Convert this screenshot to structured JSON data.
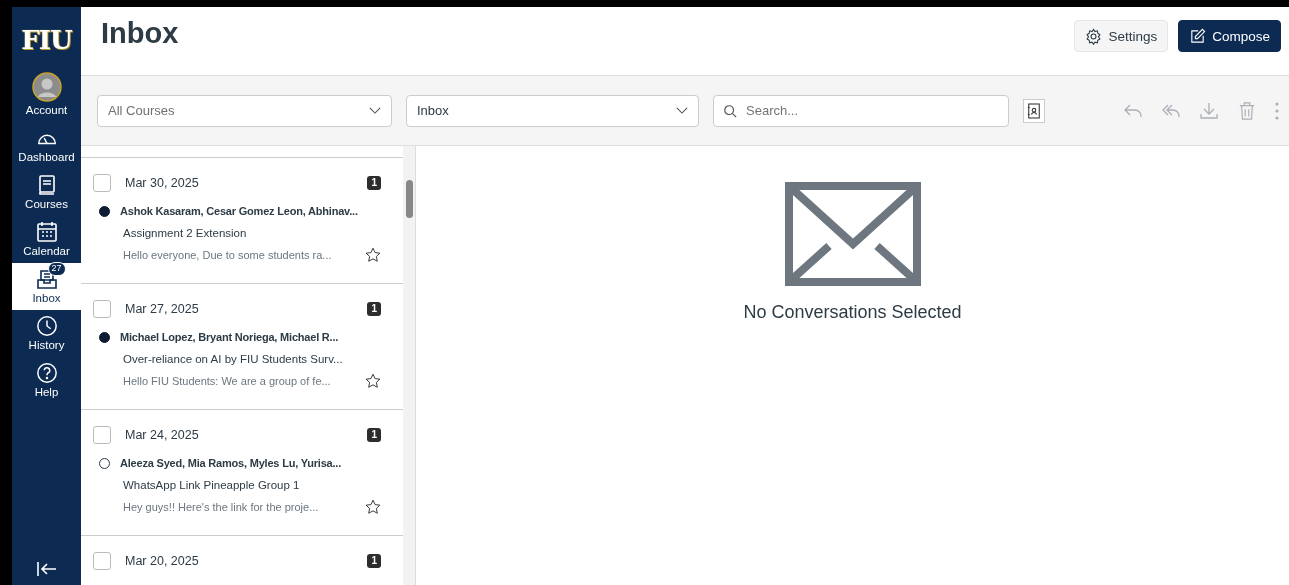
{
  "logo": "FIU",
  "nav": [
    {
      "kind": "account",
      "label": "Account",
      "selected": false
    },
    {
      "kind": "dashboard",
      "label": "Dashboard",
      "selected": false
    },
    {
      "kind": "courses",
      "label": "Courses",
      "selected": false
    },
    {
      "kind": "calendar",
      "label": "Calendar",
      "selected": false
    },
    {
      "kind": "inbox",
      "label": "Inbox",
      "selected": true,
      "badge": "27"
    },
    {
      "kind": "history",
      "label": "History",
      "selected": false
    },
    {
      "kind": "help",
      "label": "Help",
      "selected": false
    }
  ],
  "title": "Inbox",
  "settings_button": "Settings",
  "compose_button": "Compose",
  "course_filter": {
    "value": "All Courses"
  },
  "mailbox_filter": {
    "value": "Inbox"
  },
  "search": {
    "placeholder": "Search..."
  },
  "conversations": [
    {
      "date": "Mar 30, 2025",
      "count": "1",
      "checked": false,
      "unread": true,
      "starred": false,
      "participants": "Ashok Kasaram, Cesar Gomez Leon, Abhinav...",
      "subject": "Assignment 2 Extension",
      "preview": "Hello everyone, Due to some students ra..."
    },
    {
      "date": "Mar 27, 2025",
      "count": "1",
      "checked": false,
      "unread": true,
      "starred": false,
      "participants": "Michael Lopez, Bryant Noriega, Michael R...",
      "subject": "Over-reliance on AI by FIU Students Surv...",
      "preview": "Hello FIU Students: We are a group of fe..."
    },
    {
      "date": "Mar 24, 2025",
      "count": "1",
      "checked": false,
      "unread": false,
      "starred": false,
      "participants": "Aleeza Syed, Mia Ramos, Myles Lu, Yurisa...",
      "subject": "WhatsApp Link Pineapple Group 1",
      "preview": "Hey guys!! Here's the link for the proje..."
    },
    {
      "date": "Mar 20, 2025",
      "count": "1",
      "checked": false
    }
  ],
  "empty_state": "No Conversations Selected"
}
